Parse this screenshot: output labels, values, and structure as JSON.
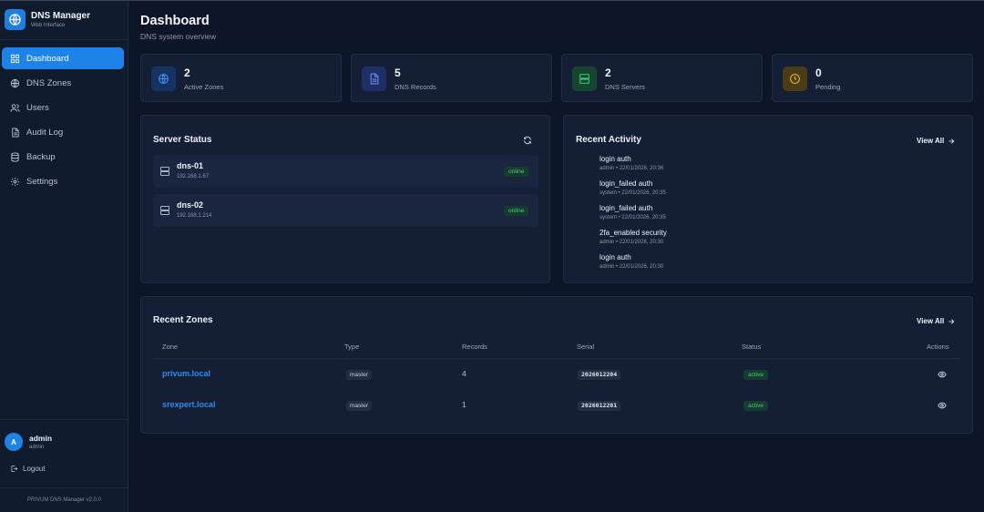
{
  "app": {
    "name": "DNS Manager",
    "subtitle": "Web Interface",
    "version": "PRIVUM DNS Manager v2.0.0"
  },
  "nav": {
    "items": [
      {
        "label": "Dashboard",
        "icon": "dashboard-icon",
        "active": true
      },
      {
        "label": "DNS Zones",
        "icon": "globe-icon",
        "active": false
      },
      {
        "label": "Users",
        "icon": "users-icon",
        "active": false
      },
      {
        "label": "Audit Log",
        "icon": "document-icon",
        "active": false
      },
      {
        "label": "Backup",
        "icon": "database-icon",
        "active": false
      },
      {
        "label": "Settings",
        "icon": "gear-icon",
        "active": false
      }
    ]
  },
  "user": {
    "initial": "A",
    "name": "admin",
    "role": "admin",
    "logout_label": "Logout"
  },
  "page": {
    "title": "Dashboard",
    "subtitle": "DNS system overview"
  },
  "stats": [
    {
      "value": "2",
      "label": "Active Zones",
      "icon": "globe-icon",
      "color": "#1d6fd6"
    },
    {
      "value": "5",
      "label": "DNS Records",
      "icon": "document-icon",
      "color": "#4a6cf0"
    },
    {
      "value": "2",
      "label": "DNS Servers",
      "icon": "server-icon",
      "color": "#2fbf6a"
    },
    {
      "value": "0",
      "label": "Pending",
      "icon": "clock-icon",
      "color": "#e6b42a"
    }
  ],
  "server_status": {
    "title": "Server Status",
    "servers": [
      {
        "name": "dns-01",
        "ip": "192.168.1.67",
        "status": "online"
      },
      {
        "name": "dns-02",
        "ip": "192.168.1.214",
        "status": "online"
      }
    ]
  },
  "recent_activity": {
    "title": "Recent Activity",
    "view_all": "View All",
    "items": [
      {
        "title": "login auth",
        "meta": "admin • 22/01/2026, 20:36"
      },
      {
        "title": "login_failed auth",
        "meta": "system • 22/01/2026, 20:35"
      },
      {
        "title": "login_failed auth",
        "meta": "system • 22/01/2026, 20:35"
      },
      {
        "title": "2fa_enabled security",
        "meta": "admin • 22/01/2026, 20:30"
      },
      {
        "title": "login auth",
        "meta": "admin • 22/01/2026, 20:30"
      }
    ]
  },
  "recent_zones": {
    "title": "Recent Zones",
    "view_all": "View All",
    "columns": [
      "Zone",
      "Type",
      "Records",
      "Serial",
      "Status",
      "Actions"
    ],
    "rows": [
      {
        "zone": "privum.local",
        "type": "master",
        "records": "4",
        "serial": "2026012204",
        "status": "active"
      },
      {
        "zone": "srexpert.local",
        "type": "master",
        "records": "1",
        "serial": "2026012201",
        "status": "active"
      }
    ]
  }
}
